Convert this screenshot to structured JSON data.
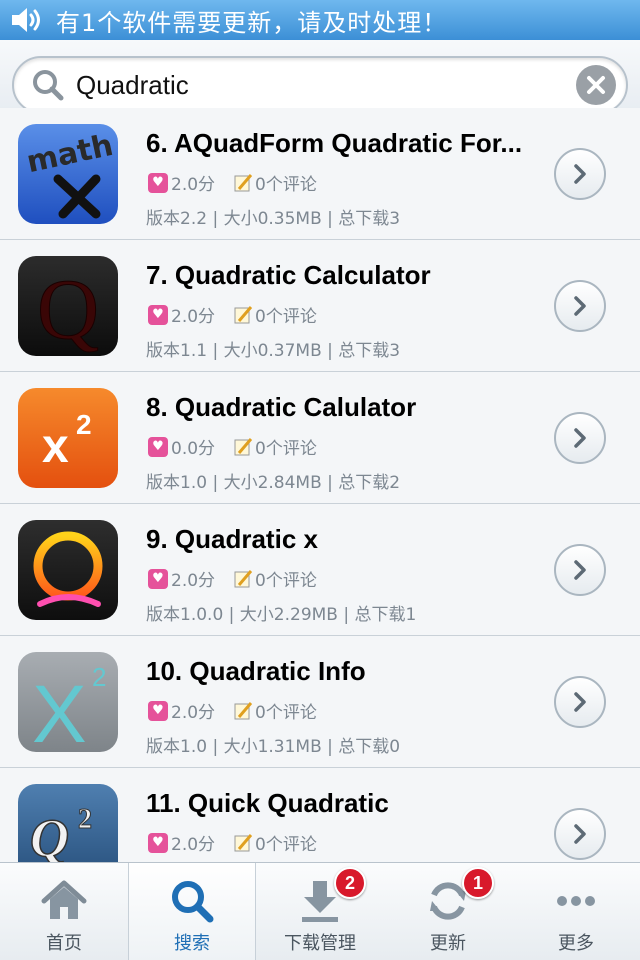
{
  "banner": {
    "text": "有1个软件需要更新，请及时处理！"
  },
  "search": {
    "query": "Quadratic"
  },
  "apps": [
    {
      "title": "6. AQuadForm Quadratic For...",
      "rating": "2.0分",
      "comments": "0个评论",
      "info": "版本2.2 | 大小0.35MB | 总下载3",
      "icon": "math-tools-icon"
    },
    {
      "title": "7. Quadratic Calculator",
      "rating": "2.0分",
      "comments": "0个评论",
      "info": "版本1.1 | 大小0.37MB | 总下载3",
      "icon": "q-letter-icon"
    },
    {
      "title": "8. Quadratic Calulator",
      "rating": "0.0分",
      "comments": "0个评论",
      "info": "版本1.0 | 大小2.84MB | 总下载2",
      "icon": "x-squared-icon"
    },
    {
      "title": "9. Quadratic x",
      "rating": "2.0分",
      "comments": "0个评论",
      "info": "版本1.0.0 | 大小2.29MB | 总下载1",
      "icon": "q-ring-icon"
    },
    {
      "title": "10. Quadratic Info",
      "rating": "2.0分",
      "comments": "0个评论",
      "info": "版本1.0 | 大小1.31MB | 总下载0",
      "icon": "big-x-squared-icon"
    },
    {
      "title": "11. Quick Quadratic",
      "rating": "2.0分",
      "comments": "0个评论",
      "info": "",
      "icon": "q-squared-icon"
    }
  ],
  "tabs": [
    {
      "label": "首页",
      "icon": "home-icon"
    },
    {
      "label": "搜索",
      "icon": "search-icon",
      "active": true
    },
    {
      "label": "下载管理",
      "icon": "download-icon",
      "badge": "2"
    },
    {
      "label": "更新",
      "icon": "refresh-icon",
      "badge": "1"
    },
    {
      "label": "更多",
      "icon": "more-icon"
    }
  ],
  "colors": {
    "banner": "#4a9fe0",
    "accent": "#1f6fb5",
    "badge": "#d8192b",
    "heart": "#e5529a"
  }
}
